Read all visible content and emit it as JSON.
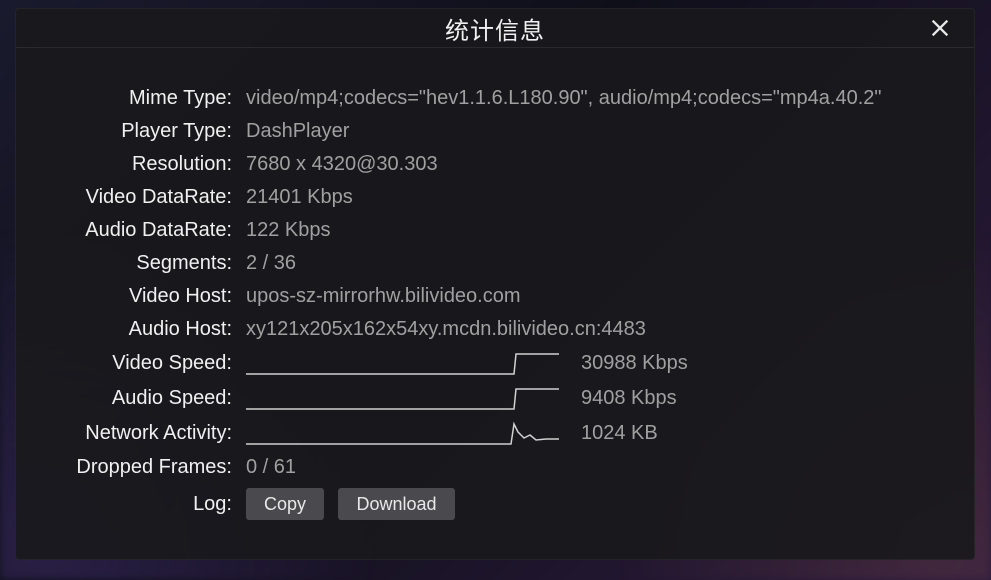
{
  "header": {
    "title": "统计信息"
  },
  "rows": {
    "mime_type": {
      "label": "Mime Type:",
      "value": "video/mp4;codecs=\"hev1.1.6.L180.90\", audio/mp4;codecs=\"mp4a.40.2\""
    },
    "player_type": {
      "label": "Player Type:",
      "value": "DashPlayer"
    },
    "resolution": {
      "label": "Resolution:",
      "value": "7680 x 4320@30.303"
    },
    "video_datarate": {
      "label": "Video DataRate:",
      "value": "21401 Kbps"
    },
    "audio_datarate": {
      "label": "Audio DataRate:",
      "value": "122 Kbps"
    },
    "segments": {
      "label": "Segments:",
      "value": "2 / 36"
    },
    "video_host": {
      "label": "Video Host:",
      "value": "upos-sz-mirrorhw.bilivideo.com"
    },
    "audio_host": {
      "label": "Audio Host:",
      "value": "xy121x205x162x54xy.mcdn.bilivideo.cn:4483"
    },
    "video_speed": {
      "label": "Video Speed:",
      "value": "30988 Kbps"
    },
    "audio_speed": {
      "label": "Audio Speed:",
      "value": "9408 Kbps"
    },
    "network_activity": {
      "label": "Network Activity:",
      "value": "1024 KB"
    },
    "dropped_frames": {
      "label": "Dropped Frames:",
      "value": "0 / 61"
    },
    "log": {
      "label": "Log:"
    }
  },
  "buttons": {
    "copy": "Copy",
    "download": "Download"
  }
}
